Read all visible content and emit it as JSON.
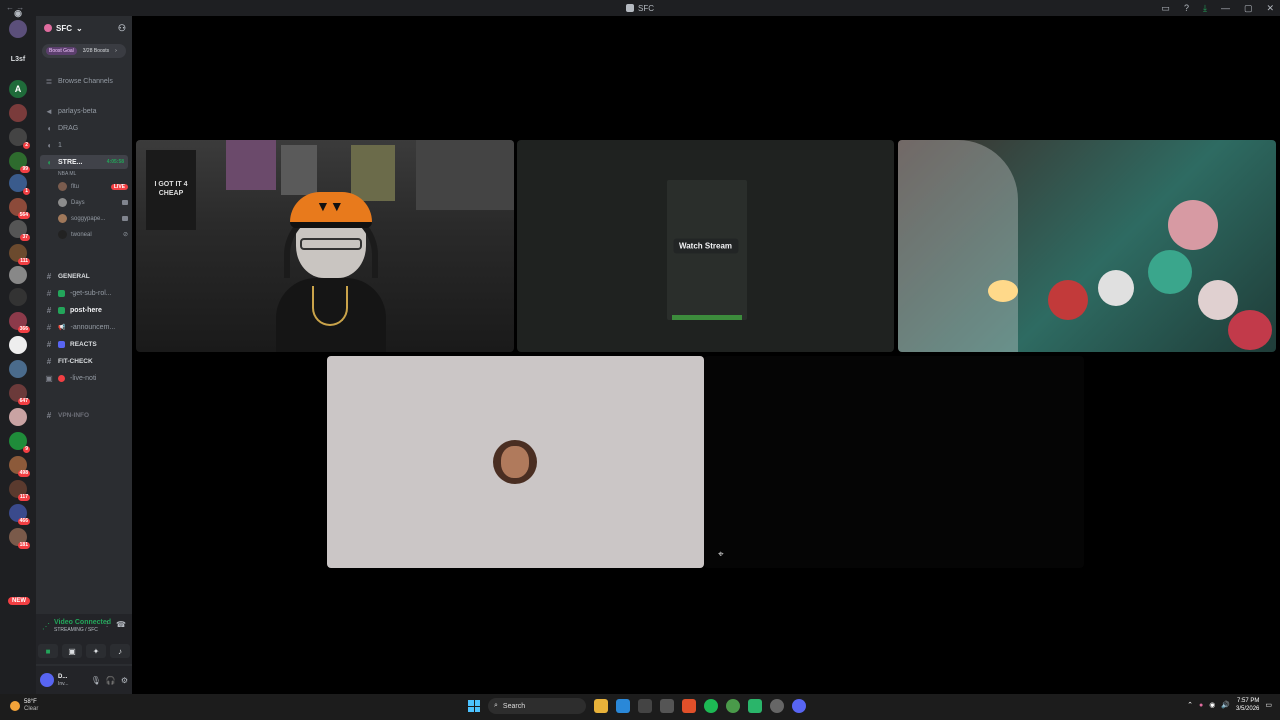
{
  "window": {
    "title": "SFC"
  },
  "servers": [
    {
      "label": "",
      "badge": "",
      "color": "#5b4f7a"
    },
    {
      "label": "L3sf",
      "badge": "",
      "color": ""
    },
    {
      "label": "A",
      "badge": "",
      "color": "#1f6b3a"
    },
    {
      "label": "",
      "badge": "",
      "color": "#7a3b3b"
    },
    {
      "label": "",
      "badge": "2",
      "color": "#444"
    },
    {
      "label": "",
      "badge": "99",
      "color": "#2e6b2e"
    },
    {
      "label": "",
      "badge": "1",
      "color": "#3a5b8c"
    },
    {
      "label": "",
      "badge": "564",
      "color": "#8c4a3a"
    },
    {
      "label": "",
      "badge": "37",
      "color": "#555"
    },
    {
      "label": "",
      "badge": "111",
      "color": "#6b4a2e"
    },
    {
      "label": "",
      "badge": "",
      "color": "#888"
    },
    {
      "label": "",
      "badge": "",
      "color": "#333"
    },
    {
      "label": "",
      "badge": "366",
      "color": "#8c3a4a"
    },
    {
      "label": "",
      "badge": "",
      "color": "#eee"
    },
    {
      "label": "",
      "badge": "",
      "color": "#4a6b8c"
    },
    {
      "label": "",
      "badge": "647",
      "color": "#6b3a3a"
    },
    {
      "label": "",
      "badge": "",
      "color": "#c9a3a3"
    },
    {
      "label": "",
      "badge": "9",
      "color": "#1f8c3a"
    },
    {
      "label": "",
      "badge": "498",
      "color": "#8c5a3a"
    },
    {
      "label": "",
      "badge": "117",
      "color": "#5a3a2e"
    },
    {
      "label": "",
      "badge": "466",
      "color": "#3a4a8c"
    },
    {
      "label": "",
      "badge": "181",
      "color": "#7a5a4a"
    }
  ],
  "new_tag": "NEW",
  "guild": {
    "name": "SFC",
    "boost_goal": "Boost Goal",
    "boost_count": "3/28 Boosts"
  },
  "channels": {
    "browse": "Browse Channels",
    "parlays": "parlays-beta",
    "drag": "DRAG",
    "one": "1",
    "stream": "STRE...",
    "stream_timer": "4:05:58",
    "stream_sub": "NBA ML",
    "users": [
      {
        "name": "fltu",
        "tag": "LIVE"
      },
      {
        "name": "Days",
        "tag": ""
      },
      {
        "name": "soggypape...",
        "tag": ""
      },
      {
        "name": "twoneal",
        "tag": ""
      }
    ],
    "general": "GENERAL",
    "get_sub": "-get-sub-rol...",
    "post_here": "post-here",
    "announcements": "-announcem...",
    "reacts": "REACTS",
    "fit_check": "FIT-CHECK",
    "live_noti": "-live-noti",
    "vpn_info": "VPN-INFO"
  },
  "voice_panel": {
    "status": "Video Connected",
    "sub": "STREAMING / SFC"
  },
  "user_panel": {
    "name": "D...",
    "status": "Inv..."
  },
  "stage": {
    "watch_stream": "Watch Stream",
    "shirt_text": "I GOT IT 4 CHEAP"
  },
  "taskbar": {
    "temp": "58°F",
    "weather": "Clear",
    "search": "Search",
    "time": "7:57 PM",
    "date": "3/5/2026"
  }
}
